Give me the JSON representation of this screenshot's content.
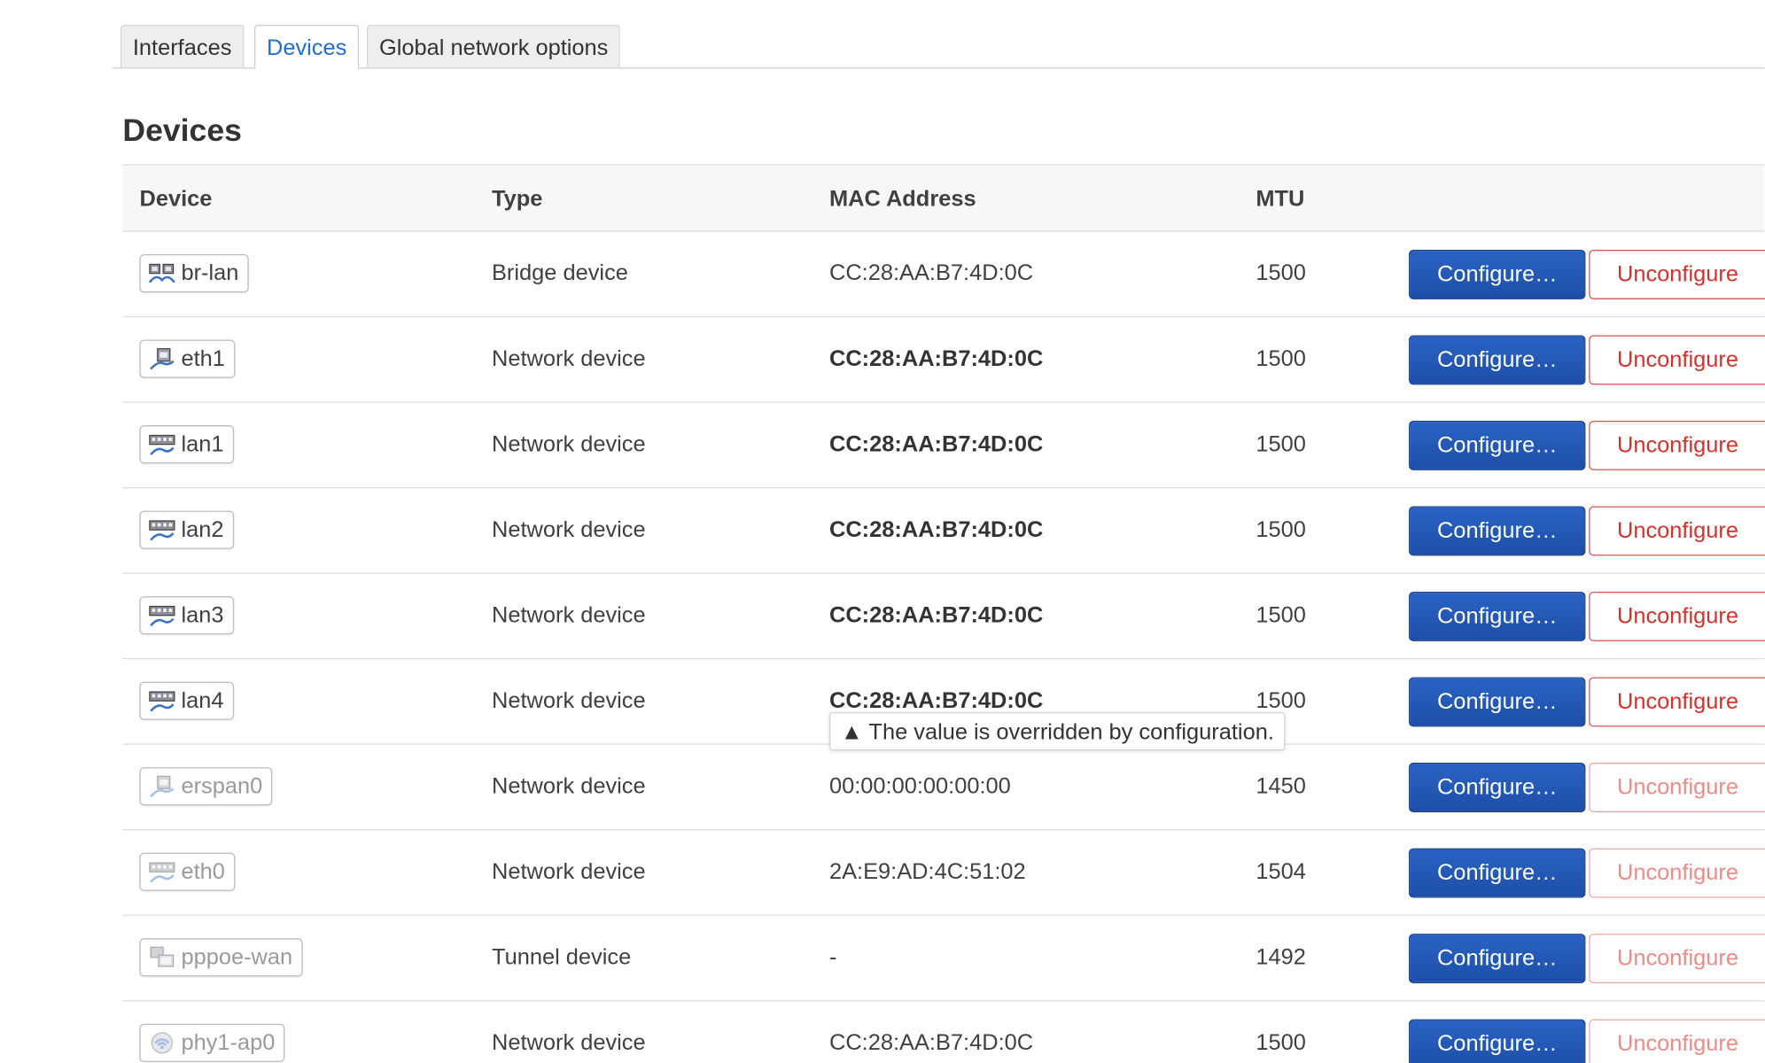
{
  "tabs": [
    {
      "label": "Interfaces",
      "active": false
    },
    {
      "label": "Devices",
      "active": true
    },
    {
      "label": "Global network options",
      "active": false
    }
  ],
  "section_title": "Devices",
  "table": {
    "headers": {
      "device": "Device",
      "type": "Type",
      "mac": "MAC Address",
      "mtu": "MTU"
    },
    "configure_label": "Configure…",
    "unconfigure_label": "Unconfigure",
    "rows": [
      {
        "device": "br-lan",
        "icon": "bridge-icon",
        "type": "Bridge device",
        "mac": "CC:28:AA:B7:4D:0C",
        "mtu": "1500",
        "active": true,
        "mac_overridden": false
      },
      {
        "device": "eth1",
        "icon": "ethernet-icon",
        "type": "Network device",
        "mac": "CC:28:AA:B7:4D:0C",
        "mtu": "1500",
        "active": true,
        "mac_overridden": true
      },
      {
        "device": "lan1",
        "icon": "switch-port-icon",
        "type": "Network device",
        "mac": "CC:28:AA:B7:4D:0C",
        "mtu": "1500",
        "active": true,
        "mac_overridden": true
      },
      {
        "device": "lan2",
        "icon": "switch-port-icon",
        "type": "Network device",
        "mac": "CC:28:AA:B7:4D:0C",
        "mtu": "1500",
        "active": true,
        "mac_overridden": true
      },
      {
        "device": "lan3",
        "icon": "switch-port-icon",
        "type": "Network device",
        "mac": "CC:28:AA:B7:4D:0C",
        "mtu": "1500",
        "active": true,
        "mac_overridden": true
      },
      {
        "device": "lan4",
        "icon": "switch-port-icon",
        "type": "Network device",
        "mac": "CC:28:AA:B7:4D:0C",
        "mtu": "1500",
        "active": true,
        "mac_overridden": true
      },
      {
        "device": "erspan0",
        "icon": "ethernet-icon",
        "type": "Network device",
        "mac": "00:00:00:00:00:00",
        "mtu": "1450",
        "active": false,
        "mac_overridden": false
      },
      {
        "device": "eth0",
        "icon": "switch-port-icon",
        "type": "Network device",
        "mac": "2A:E9:AD:4C:51:02",
        "mtu": "1504",
        "active": false,
        "mac_overridden": false
      },
      {
        "device": "pppoe-wan",
        "icon": "tunnel-icon",
        "type": "Tunnel device",
        "mac": "-",
        "mtu": "1492",
        "active": false,
        "mac_overridden": false
      },
      {
        "device": "phy1-ap0",
        "icon": "wifi-icon",
        "type": "Network device",
        "mac": "CC:28:AA:B7:4D:0C",
        "mtu": "1500",
        "active": false,
        "mac_overridden": false
      }
    ]
  },
  "tooltip": {
    "text": "▲ The value is overridden by configuration."
  },
  "colors": {
    "accent": "#1f6fd0",
    "configure_bg": "#2258b6",
    "unconfigure": "#d9302b"
  }
}
